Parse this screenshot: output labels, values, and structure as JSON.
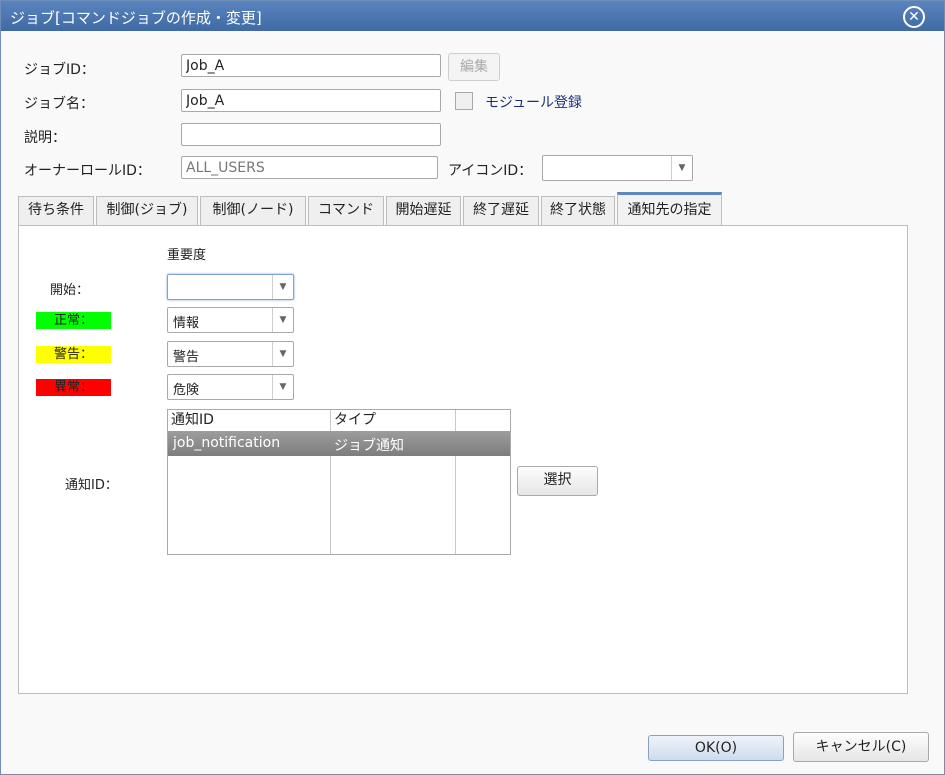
{
  "window": {
    "title": "ジョブ[コマンドジョブの作成・変更]",
    "close_icon": "close-icon"
  },
  "form": {
    "job_id_label": "ジョブID：",
    "job_id_value": "Job_A",
    "edit_button": "編集",
    "job_name_label": "ジョブ名：",
    "job_name_value": "Job_A",
    "module_label": "モジュール登録",
    "description_label": "説明：",
    "description_value": "",
    "owner_role_label": "オーナーロールID：",
    "owner_role_value": "ALL_USERS",
    "icon_id_label": "アイコンID：",
    "icon_id_value": ""
  },
  "tabs": [
    {
      "label": "待ち条件"
    },
    {
      "label": "制御(ジョブ)"
    },
    {
      "label": "制御(ノード)"
    },
    {
      "label": "コマンド"
    },
    {
      "label": "開始遅延"
    },
    {
      "label": "終了遅延"
    },
    {
      "label": "終了状態"
    },
    {
      "label": "通知先の指定",
      "active": true
    }
  ],
  "notification": {
    "severity_header": "重要度",
    "start_label": "開始：",
    "start_value": "",
    "normal_label": "正常：",
    "normal_value": "情報",
    "warning_label": "警告：",
    "warning_value": "警告",
    "error_label": "異常：",
    "error_value": "危険",
    "colors": {
      "normal": "#00ff00",
      "warning": "#ffff00",
      "error": "#ff0000"
    },
    "notify_id_label": "通知ID：",
    "table": {
      "columns": [
        "通知ID",
        "タイプ"
      ],
      "rows": [
        {
          "id": "job_notification",
          "type": "ジョブ通知"
        }
      ]
    },
    "select_button": "選択"
  },
  "footer": {
    "ok_button": "OK(O)",
    "cancel_button": "キャンセル(C)"
  }
}
